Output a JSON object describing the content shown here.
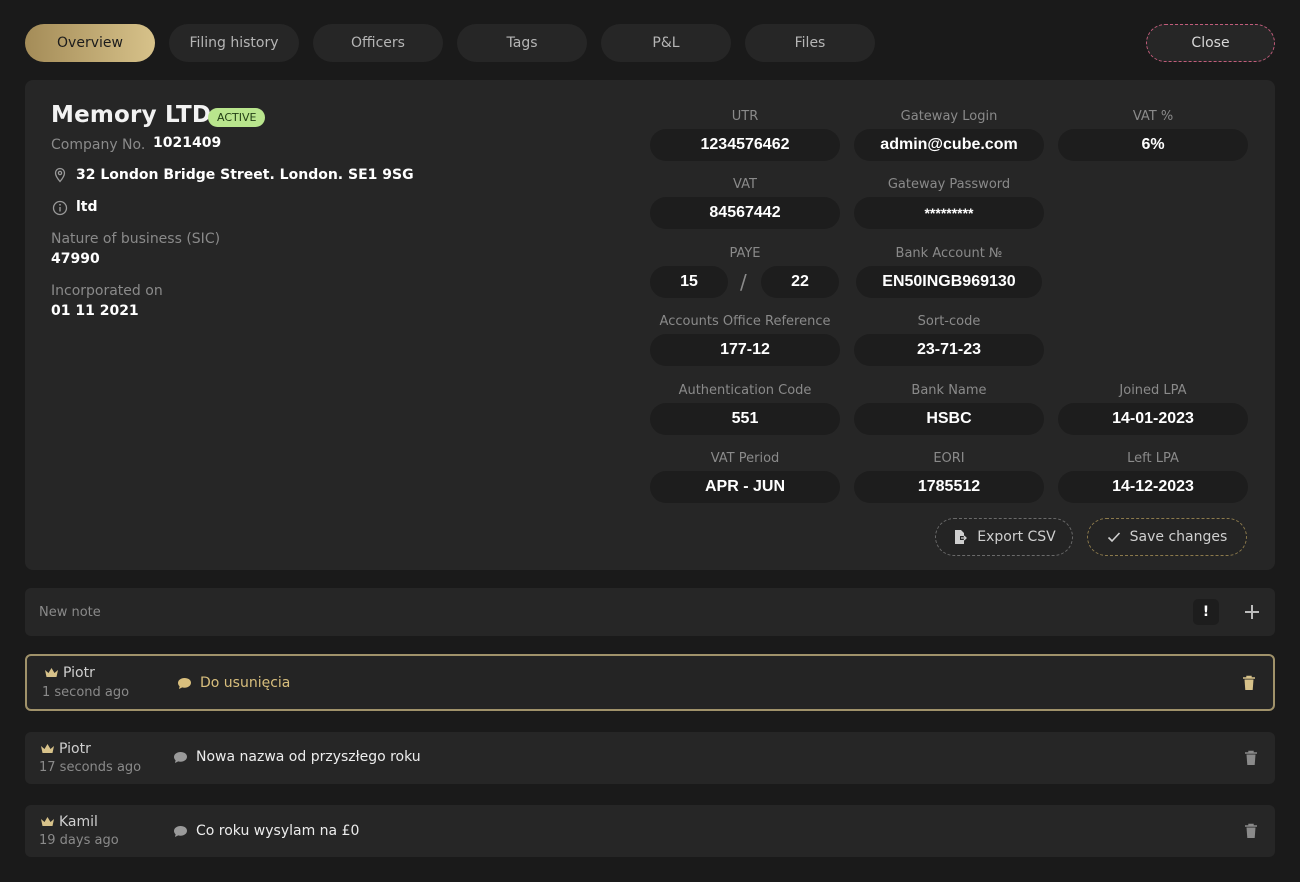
{
  "tabs": [
    {
      "label": "Overview",
      "active": true
    },
    {
      "label": "Filing history",
      "active": false
    },
    {
      "label": "Officers",
      "active": false
    },
    {
      "label": "Tags",
      "active": false
    },
    {
      "label": "P&L",
      "active": false
    },
    {
      "label": "Files",
      "active": false
    }
  ],
  "close_label": "Close",
  "company": {
    "name": "Memory LTD",
    "status": "ACTIVE",
    "number_label": "Company No.",
    "number": "1021409",
    "address": "32 London Bridge Street.  London. SE1 9SG",
    "type": "ltd",
    "sic_label": "Nature of business (SIC)",
    "sic": "47990",
    "incorporated_label": "Incorporated on",
    "incorporated": "01 11 2021"
  },
  "fields": {
    "utr": {
      "label": "UTR",
      "value": "1234576462"
    },
    "gateway_login": {
      "label": "Gateway Login",
      "value": "admin@cube.com"
    },
    "vat_percent": {
      "label": "VAT %",
      "value": "6%"
    },
    "vat": {
      "label": "VAT",
      "value": "84567442"
    },
    "gateway_password": {
      "label": "Gateway Password",
      "value": "*********"
    },
    "paye": {
      "label": "PAYE",
      "value_1": "15",
      "separator": "/",
      "value_2": "22"
    },
    "bank_account": {
      "label": "Bank Account №",
      "value": "EN50INGB969130"
    },
    "accounts_office_ref": {
      "label": "Accounts Office Reference",
      "value": "177-12"
    },
    "sort_code": {
      "label": "Sort-code",
      "value": "23-71-23"
    },
    "auth_code": {
      "label": "Authentication Code",
      "value": "551"
    },
    "bank_name": {
      "label": "Bank Name",
      "value": "HSBC"
    },
    "joined_lpa": {
      "label": "Joined LPA",
      "value": "14-01-2023"
    },
    "vat_period": {
      "label": "VAT Period",
      "value": "APR - JUN"
    },
    "eori": {
      "label": "EORI",
      "value": "1785512"
    },
    "left_lpa": {
      "label": "Left LPA",
      "value": "14-12-2023"
    }
  },
  "actions": {
    "export_label": "Export CSV",
    "save_label": "Save changes"
  },
  "new_note": {
    "placeholder": "New note",
    "priority_label": "!"
  },
  "notes": [
    {
      "author": "Piotr",
      "time": "1 second ago",
      "text": "Do usunięcia",
      "highlighted": true
    },
    {
      "author": "Piotr",
      "time": "17 seconds ago",
      "text": "Nowa nazwa od przyszłego roku",
      "highlighted": false
    },
    {
      "author": "Kamil",
      "time": "19 days ago",
      "text": "Co roku wysylam na £0",
      "highlighted": false
    }
  ],
  "colors": {
    "background": "#1a1a1a",
    "panel": "#262626",
    "gold_accent": "#d7c28a",
    "active_badge": "#b9e58d",
    "close_border": "#c25c7b"
  }
}
